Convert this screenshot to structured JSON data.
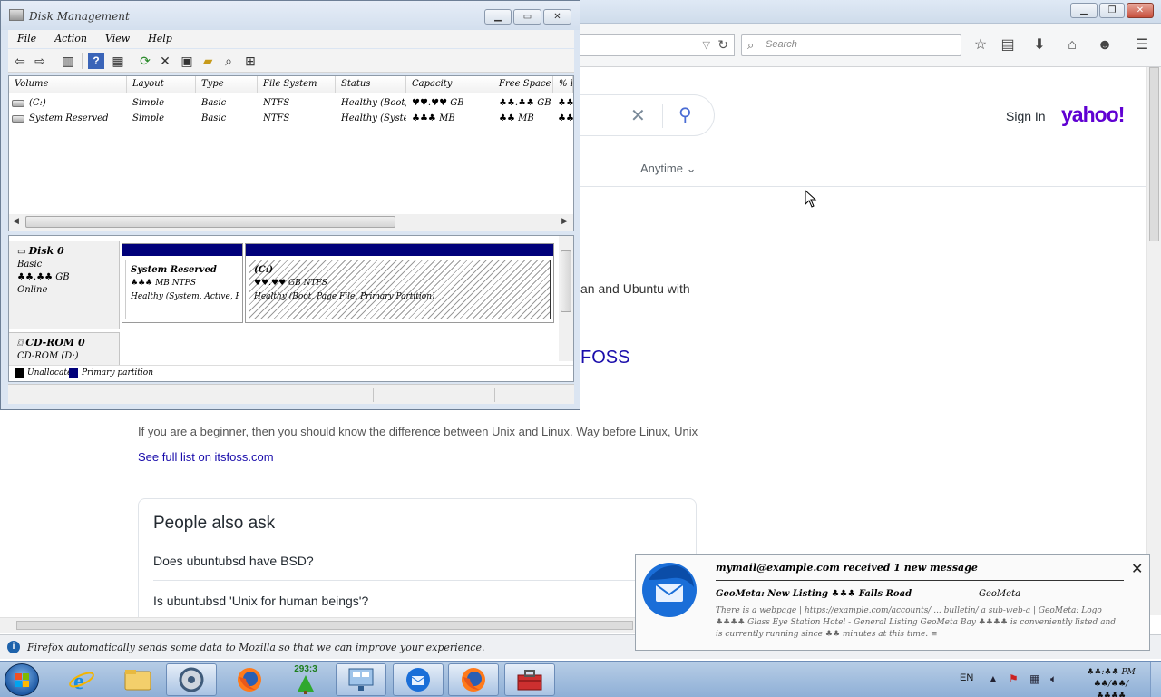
{
  "firefox": {
    "search_placeholder": "Search",
    "notification_text": "Firefox automatically sends some data to Mozilla so that we can improve your experience."
  },
  "yahoo": {
    "sign_in": "Sign In",
    "logo": "yahoo!",
    "anytime_filter": "Anytime",
    "snippet_1": "an and Ubuntu with",
    "result_title_fragment": "FOSS",
    "snippet_2": "If you are a beginner, then you should know the difference between Unix and Linux. Way before Linux, Unix",
    "see_full_list": "See full list on itsfoss.com",
    "people_also_ask": {
      "title": "People also ask",
      "questions": [
        "Does ubuntubsd have BSD?",
        "Is ubuntubsd 'Unix for human beings'?"
      ]
    }
  },
  "disk_management": {
    "title": "Disk Management",
    "menus": [
      "File",
      "Action",
      "View",
      "Help"
    ],
    "columns": [
      "Volume",
      "Layout",
      "Type",
      "File System",
      "Status",
      "Capacity",
      "Free Space",
      "% F"
    ],
    "volumes": [
      {
        "volume": "(C:)",
        "layout": "Simple",
        "type": "Basic",
        "fs": "NTFS",
        "status": "Healthy (Boot, ...",
        "capacity": "♥♥.♥♥ GB",
        "free": "♣♣.♣♣ GB",
        "pct": "♣♣"
      },
      {
        "volume": "System Reserved",
        "layout": "Simple",
        "type": "Basic",
        "fs": "NTFS",
        "status": "Healthy (Syste...",
        "capacity": "♣♣♣ MB",
        "free": "♣♣ MB",
        "pct": "♣♣"
      }
    ],
    "disks": [
      {
        "name": "Disk 0",
        "type": "Basic",
        "size": "♣♣.♣♣ GB",
        "state": "Online",
        "partitions": [
          {
            "name": "System Reserved",
            "size": "♣♣♣ MB NTFS",
            "status": "Healthy (System, Active, Primary"
          },
          {
            "name": "(C:)",
            "size": "♥♥.♥♥ GB NTFS",
            "status": "Healthy (Boot, Page File, Primary Partition)"
          }
        ]
      },
      {
        "name": "CD-ROM 0",
        "type": "CD-ROM (D:)"
      }
    ],
    "legend": [
      {
        "label": "Unallocated",
        "color": "#000000"
      },
      {
        "label": "Primary partition",
        "color": "#00007a"
      }
    ]
  },
  "thunderbird_notification": {
    "header": "mymail@example.com received 1 new message",
    "subject": "GeoMeta: New Listing ♣♣♣ Falls Road",
    "from": "GeoMeta",
    "body": "There is a webpage | https://example.com/accounts/ ... bulletin/ a sub-web-a | GeoMeta: Logo ♣♣♣♣ Glass Eye Station Hotel - General Listing GeoMeta Bay ♣♣♣♣ is conveniently listed and is currently running since ♣♣ minutes at this time. ≡"
  },
  "taskbar": {
    "notepad_badge": "293:3",
    "language": "EN",
    "time": "♣♣:♣♣ PM",
    "date": "♣♣/♣♣/♣♣♣♣"
  }
}
